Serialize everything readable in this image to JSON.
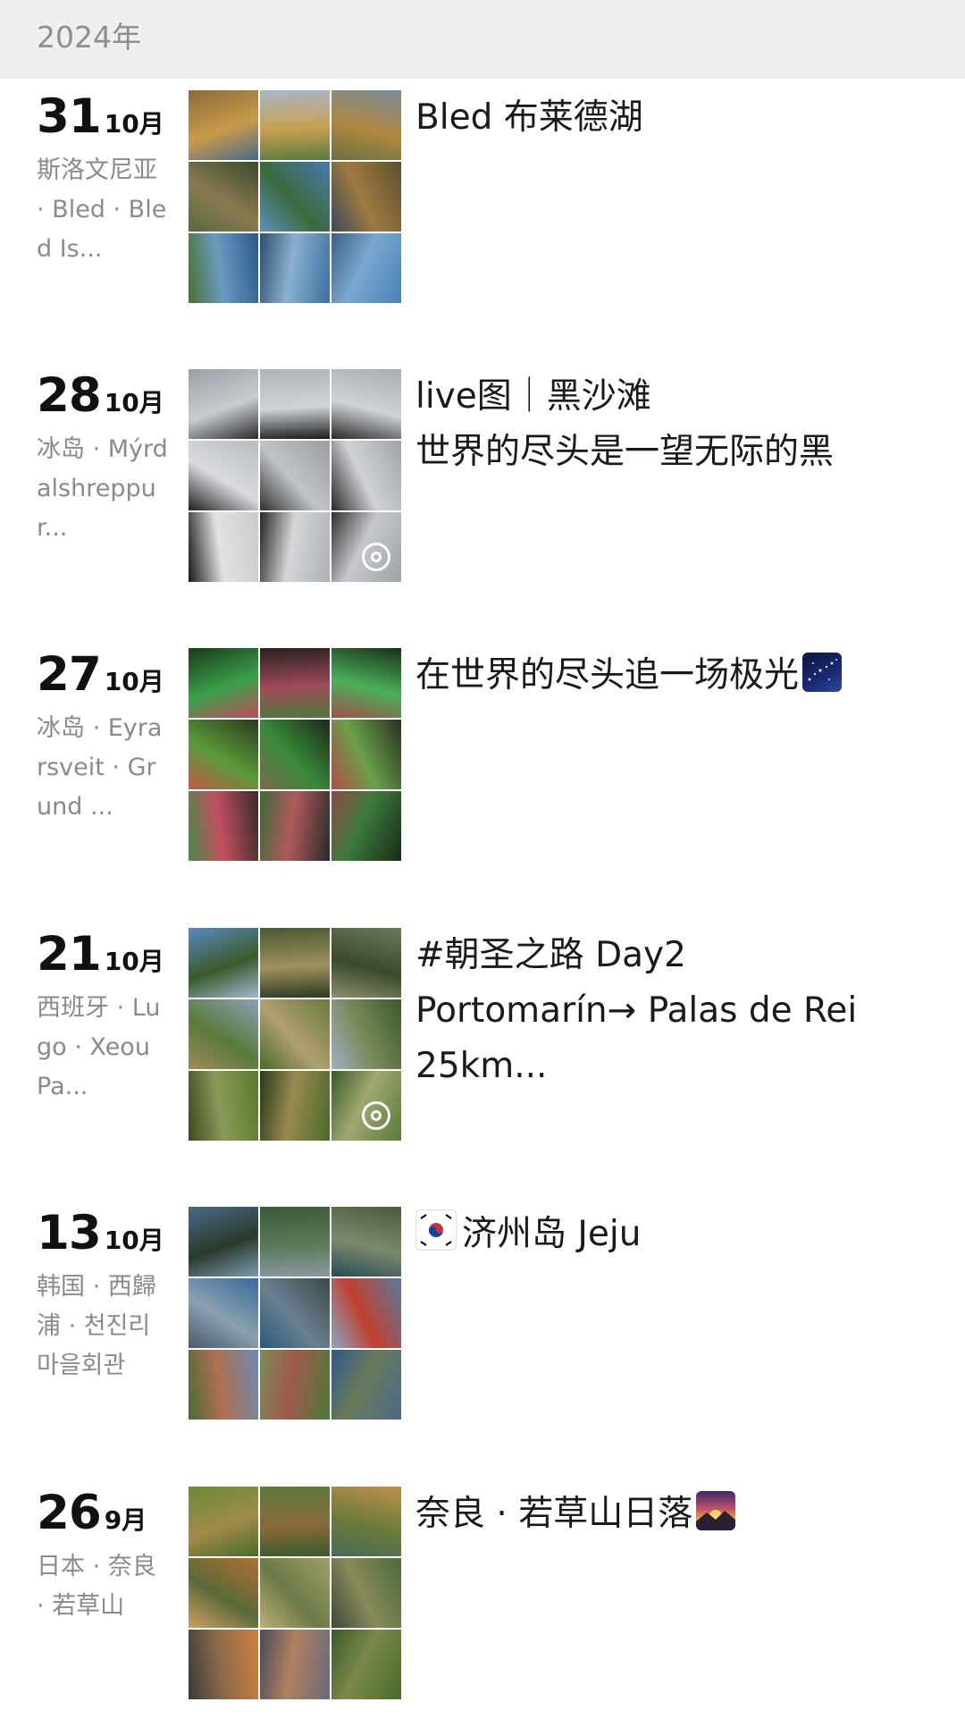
{
  "header": {
    "year": "2024年"
  },
  "entries": [
    {
      "day": "31",
      "month": "10月",
      "location": "斯洛文尼亚 · Bled · Bled Is...",
      "caption": [
        "Bled 布莱德湖"
      ],
      "live": false,
      "thumbs": [
        [
          "#8a6a3a",
          "#c89a4a",
          "#4a6a8a"
        ],
        [
          "#a8b6c8",
          "#c8a050",
          "#5a7a40"
        ],
        [
          "#7a8a9a",
          "#b08840",
          "#6a7040"
        ],
        [
          "#3a4a30",
          "#8a7a50",
          "#5a6a40"
        ],
        [
          "#4a7ab0",
          "#3a6a3a",
          "#5a90c0"
        ],
        [
          "#5a5030",
          "#a07a40",
          "#3a4a5a"
        ],
        [
          "#2a5a8a",
          "#6a9ac0",
          "#4a7030"
        ],
        [
          "#3a70a0",
          "#8ab0d0",
          "#2a5070"
        ],
        [
          "#4a80b8",
          "#7aa8d0",
          "#3a6080"
        ]
      ]
    },
    {
      "day": "28",
      "month": "10月",
      "location": "冰岛 · Mýrdalshreppur...",
      "caption": [
        "live图｜黑沙滩",
        "世界的尽头是一望无际的黑"
      ],
      "live": true,
      "thumbs": [
        [
          "#9aa0a6",
          "#c8ccd0",
          "#2a2a2a"
        ],
        [
          "#b0b4b8",
          "#d0d4d8",
          "#1a1a1a"
        ],
        [
          "#a8acb0",
          "#cfd2d6",
          "#2a2a2a"
        ],
        [
          "#b8bcc0",
          "#d8dade",
          "#202020"
        ],
        [
          "#9a9ea2",
          "#c0c4c8",
          "#303030"
        ],
        [
          "#a0a4a8",
          "#d0d2d6",
          "#282828"
        ],
        [
          "#c8cacc",
          "#e0e2e4",
          "#181818"
        ],
        [
          "#aeb2b6",
          "#d4d6d8",
          "#262626"
        ],
        [
          "#9ea2a6",
          "#c6c8cc",
          "#303030"
        ]
      ]
    },
    {
      "day": "27",
      "month": "10月",
      "location": "冰岛 · Eyrarsveit · Grund ...",
      "caption": [
        "在世界的尽头追一场极光"
      ],
      "caption_emoji": "night-sky",
      "live": false,
      "thumbs": [
        [
          "#1a3a1a",
          "#3aa04a",
          "#c04a5a"
        ],
        [
          "#2a2020",
          "#a04a5a",
          "#4a7a3a"
        ],
        [
          "#1a301a",
          "#4ab05a",
          "#a0504a"
        ],
        [
          "#2a3a20",
          "#5a9a3a",
          "#c05a4a"
        ],
        [
          "#1a2a1a",
          "#3a8a3a",
          "#7a6a4a"
        ],
        [
          "#2a3020",
          "#6aa04a",
          "#b04a4a"
        ],
        [
          "#3a2a2a",
          "#c05060",
          "#4a8a4a"
        ],
        [
          "#2a2a2a",
          "#b05a5a",
          "#3a6a3a"
        ],
        [
          "#1a2a1a",
          "#3a7a3a",
          "#904a4a"
        ]
      ]
    },
    {
      "day": "21",
      "month": "10月",
      "location": "西班牙 · Lugo · Xeou Pa...",
      "caption": [
        "#朝圣之路 Day2",
        "Portomarín→ Palas de Rei",
        "25km..."
      ],
      "live": true,
      "thumbs": [
        [
          "#5a8ac0",
          "#3a5a2a",
          "#a0b8d0"
        ],
        [
          "#4a5a30",
          "#a09060",
          "#2a3a20"
        ],
        [
          "#6a7a5a",
          "#3a4a2a",
          "#8a9070"
        ],
        [
          "#8aa0b8",
          "#5a7a3a",
          "#a08a5a"
        ],
        [
          "#6a7a3a",
          "#b0a070",
          "#4a6a2a"
        ],
        [
          "#3a5a2a",
          "#7a8a5a",
          "#a0b0c0"
        ],
        [
          "#5a7a2a",
          "#8a9a5a",
          "#3a4a20"
        ],
        [
          "#4a6a2a",
          "#9a8a50",
          "#2a3a1a"
        ],
        [
          "#5a7a3a",
          "#a0a870",
          "#3a5a2a"
        ]
      ]
    },
    {
      "day": "13",
      "month": "10月",
      "location": "韩国 · 西歸浦 · 천진리마을회관",
      "caption": [
        "济州岛 Jeju"
      ],
      "caption_flag": "korea-flag",
      "live": false,
      "thumbs": [
        [
          "#4a6a8a",
          "#2a3a2a",
          "#7a9ab0"
        ],
        [
          "#3a5a3a",
          "#5a7a5a",
          "#8a9aa0"
        ],
        [
          "#4a5a3a",
          "#7a8a6a",
          "#2a4a5a"
        ],
        [
          "#3a6a9a",
          "#8aa0b0",
          "#4a5a6a"
        ],
        [
          "#3a4a4a",
          "#6a8090",
          "#2a5a7a"
        ],
        [
          "#5a7a9a",
          "#c04030",
          "#8aa8c0"
        ],
        [
          "#6a8ab0",
          "#b07050",
          "#4a6a3a"
        ],
        [
          "#4a7a3a",
          "#a05a4a",
          "#7a8a5a"
        ],
        [
          "#4a6a8a",
          "#6a7a5a",
          "#2a5a8a"
        ]
      ]
    },
    {
      "day": "26",
      "month": "9月",
      "location": "日本 · 奈良 · 若草山",
      "caption": [
        "奈良 · 若草山日落"
      ],
      "caption_emoji": "sunset",
      "live": false,
      "thumbs": [
        [
          "#6a8a3a",
          "#a08a4a",
          "#4a6a2a"
        ],
        [
          "#5a7a3a",
          "#8a6a3a",
          "#3a5a2a"
        ],
        [
          "#c09050",
          "#6a7a3a",
          "#4a6a5a"
        ],
        [
          "#b07030",
          "#5a6a3a",
          "#d0a060"
        ],
        [
          "#a0a060",
          "#6a7a4a",
          "#c0b070"
        ],
        [
          "#4a6a3a",
          "#8a8a5a",
          "#3a4a3a"
        ],
        [
          "#d08040",
          "#8a6a4a",
          "#3a3a3a"
        ],
        [
          "#6a6a7a",
          "#b08060",
          "#4a4a5a"
        ],
        [
          "#4a6a2a",
          "#7a8a4a",
          "#3a5a2a"
        ]
      ]
    }
  ]
}
